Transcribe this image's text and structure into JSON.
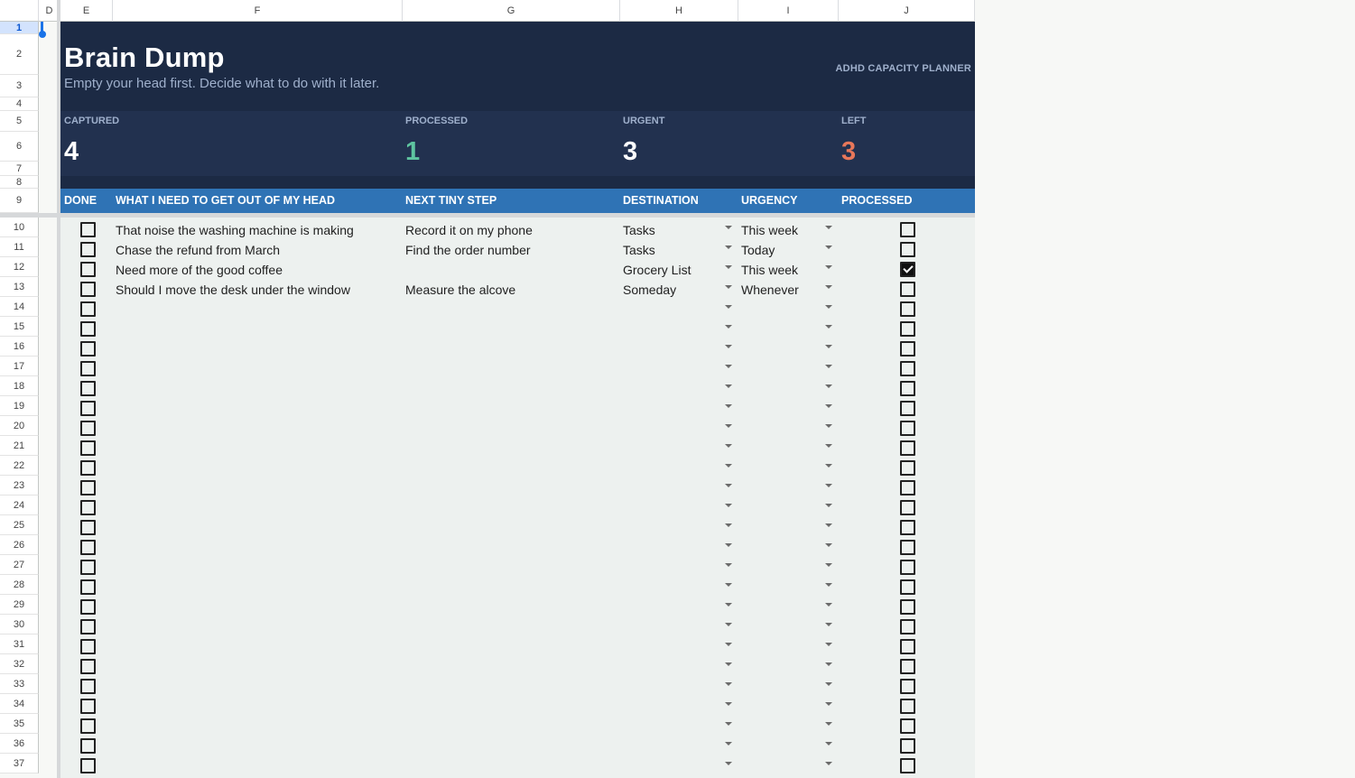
{
  "columns": [
    "D",
    "E",
    "F",
    "G",
    "H",
    "I",
    "J"
  ],
  "rows": [
    "1",
    "2",
    "3",
    "4",
    "5",
    "6",
    "7",
    "8",
    "9",
    "10",
    "11",
    "12",
    "13",
    "14",
    "15",
    "16",
    "17",
    "18",
    "19",
    "20",
    "21",
    "22",
    "23",
    "24",
    "25",
    "26",
    "27",
    "28",
    "29",
    "30",
    "31",
    "32",
    "33",
    "34",
    "35",
    "36",
    "37"
  ],
  "header": {
    "title": "Brain Dump",
    "subtitle": "Empty your head first. Decide what to do with it later.",
    "tag": "ADHD CAPACITY PLANNER"
  },
  "stats": [
    {
      "label": "CAPTURED",
      "value": "4",
      "color": "#ffffff"
    },
    {
      "label": "PROCESSED",
      "value": "1",
      "color": "#5ec4a0"
    },
    {
      "label": "URGENT",
      "value": "3",
      "color": "#ffffff"
    },
    {
      "label": "LEFT",
      "value": "3",
      "color": "#e8775a"
    }
  ],
  "table": {
    "headers": [
      "DONE",
      "WHAT I NEED TO GET OUT OF MY HEAD",
      "NEXT TINY STEP",
      "DESTINATION",
      "URGENCY",
      "PROCESSED"
    ],
    "rows": [
      {
        "done": false,
        "item": "That noise the washing machine is making",
        "step": "Record it on my phone",
        "destination": "Tasks",
        "urgency": "This week",
        "processed": false
      },
      {
        "done": false,
        "item": "Chase the refund from March",
        "step": "Find the order number",
        "destination": "Tasks",
        "urgency": "Today",
        "processed": false
      },
      {
        "done": false,
        "item": "Need more of the good coffee",
        "step": "",
        "destination": "Grocery List",
        "urgency": "This week",
        "processed": true
      },
      {
        "done": false,
        "item": "Should I move the desk under the window",
        "step": "Measure the alcove",
        "destination": "Someday",
        "urgency": "Whenever",
        "processed": false
      }
    ],
    "empty_rows": 24
  },
  "colors": {
    "hero": "#1c2a44",
    "stats": "#22314f",
    "table_header": "#2f73b5",
    "grid": "#edf1ef"
  }
}
